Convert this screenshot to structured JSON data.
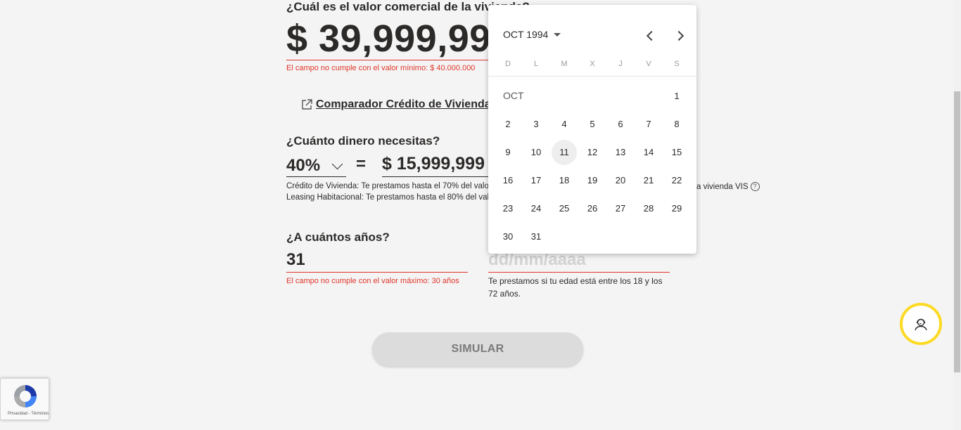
{
  "property_value": {
    "question": "¿Cuál es el valor comercial de la vivienda?",
    "amount": "$ 39,999,999",
    "error": "El campo no cumple con el valor mínimo: $ 40.000.000"
  },
  "comparator_link": {
    "label": "Comparador Crédito de Vivienda y Leasing Habitacional"
  },
  "loan_amount": {
    "question": "¿Cuánto dinero necesitas?",
    "percentage": "40%",
    "equals": "=",
    "amount": "$ 15,999,999",
    "help_credito": "Crédito de Vivienda: Te prestamos hasta el 70% del valor de la vivienda y hasta el 80% si es una vivienda VIS",
    "help_leasing": "Leasing Habitacional: Te prestamos hasta el 80% del valor de la vivienda",
    "help_tail": "a vivienda VIS",
    "help_icon": "?"
  },
  "term": {
    "question": "¿A cuántos años?",
    "value": "31",
    "error": "El campo no cumple con el valor máximo: 30 años"
  },
  "birthdate": {
    "placeholder": "dd/mm/aaaa",
    "help": "Te prestamos si tu edad está entre los 18 y los 72 años."
  },
  "simulate_button": {
    "label": "SIMULAR"
  },
  "calendar": {
    "month_year": "OCT 1994",
    "month_label": "OCT",
    "weekdays": [
      "D",
      "L",
      "M",
      "X",
      "J",
      "V",
      "S"
    ],
    "weeks": [
      [
        "",
        "",
        "",
        "",
        "",
        "",
        "1"
      ],
      [
        "2",
        "3",
        "4",
        "5",
        "6",
        "7",
        "8"
      ],
      [
        "9",
        "10",
        "11",
        "12",
        "13",
        "14",
        "15"
      ],
      [
        "16",
        "17",
        "18",
        "19",
        "20",
        "21",
        "22"
      ],
      [
        "23",
        "24",
        "25",
        "26",
        "27",
        "28",
        "29"
      ],
      [
        "30",
        "31",
        "",
        "",
        "",
        "",
        ""
      ]
    ],
    "highlighted_day": "11"
  },
  "recaptcha": {
    "text": "Privacidad - Términos"
  },
  "colors": {
    "error": "#e0362b",
    "accent_yellow": "#fdda24",
    "text": "#2c2a29",
    "button_bg": "#dcdcdc"
  },
  "icons": {
    "external_link": "external-link-icon",
    "chevron_down": "chevron-down-icon",
    "help": "help-circle-icon",
    "calendar_prev": "chevron-left-icon",
    "calendar_next": "chevron-right-icon",
    "month_dropdown": "caret-down-icon",
    "support": "support-agent-icon",
    "recaptcha": "recaptcha-logo-icon"
  }
}
